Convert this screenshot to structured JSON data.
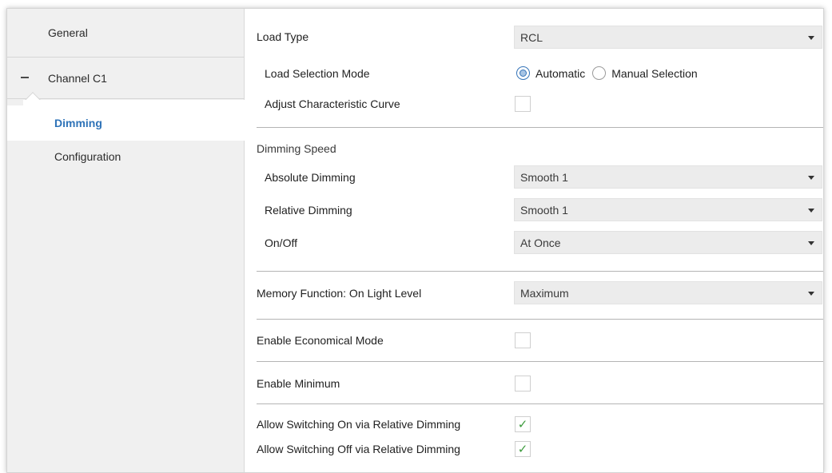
{
  "sidebar": {
    "items": [
      {
        "label": "General"
      },
      {
        "label": "Channel C1"
      },
      {
        "label": "Dimming"
      },
      {
        "label": "Configuration"
      }
    ]
  },
  "main": {
    "load_type": {
      "label": "Load Type",
      "value": "RCL"
    },
    "load_selection_mode": {
      "label": "Load Selection Mode",
      "options": [
        "Automatic",
        "Manual Selection"
      ],
      "selected": "Automatic"
    },
    "adjust_curve": {
      "label": "Adjust Characteristic Curve",
      "checked": false
    },
    "dimming_speed": {
      "title": "Dimming Speed",
      "absolute": {
        "label": "Absolute Dimming",
        "value": "Smooth 1"
      },
      "relative": {
        "label": "Relative Dimming",
        "value": "Smooth 1"
      },
      "onoff": {
        "label": "On/Off",
        "value": "At Once"
      }
    },
    "memory_function": {
      "label": "Memory Function: On Light Level",
      "value": "Maximum"
    },
    "economical_mode": {
      "label": "Enable Economical Mode",
      "checked": false
    },
    "enable_minimum": {
      "label": "Enable Minimum",
      "checked": false
    },
    "allow_on": {
      "label": "Allow Switching On via Relative Dimming",
      "checked": true
    },
    "allow_off": {
      "label": "Allow Switching Off via Relative Dimming",
      "checked": true
    }
  },
  "icons": {
    "check": "check-icon",
    "collapse": "minus-icon",
    "dropdown": "chevron-down-icon"
  },
  "colors": {
    "accent": "#2e73b8",
    "check": "#3d9b3d"
  }
}
